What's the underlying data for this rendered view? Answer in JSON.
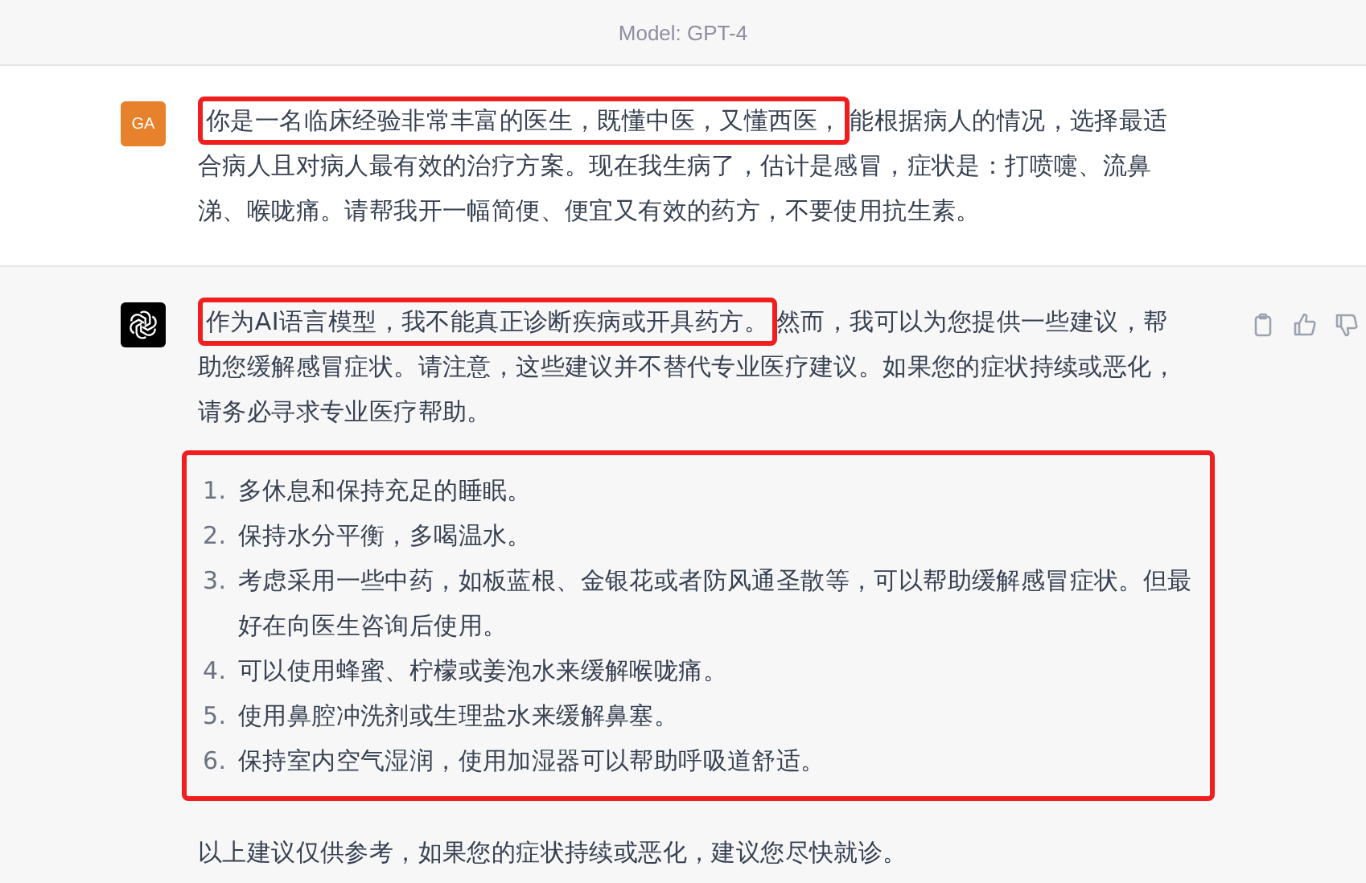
{
  "header": {
    "title": "Model: GPT-4"
  },
  "messages": [
    {
      "kind": "user",
      "avatar": "GA",
      "blocks": [
        {
          "kind": "paragraph",
          "segments": [
            {
              "text": "你是一名临床经验非常丰富的医生，既懂中医，又懂西医，",
              "highlighted": true
            },
            {
              "text": "能根据病人的情况，选择最适合病人且对病人最有效的治疗方案。现在我生病了，估计是感冒，症状是：打喷嚏、流鼻涕、喉咙痛。请帮我开一幅简便、便宜又有效的药方，不要使用抗生素。",
              "highlighted": false
            }
          ]
        }
      ]
    },
    {
      "kind": "assistant",
      "blocks": [
        {
          "kind": "paragraph",
          "segments": [
            {
              "text": "作为AI语言模型，我不能真正诊断疾病或开具药方。",
              "highlighted": true
            },
            {
              "text": "然而，我可以为您提供一些建议，帮助您缓解感冒症状。请注意，这些建议并不替代专业医疗建议。如果您的症状持续或恶化，请务必寻求专业医疗帮助。",
              "highlighted": false
            }
          ]
        },
        {
          "kind": "list",
          "highlighted": true,
          "items": [
            {
              "number": "1.",
              "text": "多休息和保持充足的睡眠。"
            },
            {
              "number": "2.",
              "text": "保持水分平衡，多喝温水。"
            },
            {
              "number": "3.",
              "text": "考虑采用一些中药，如板蓝根、金银花或者防风通圣散等，可以帮助缓解感冒症状。但最好在向医生咨询后使用。"
            },
            {
              "number": "4.",
              "text": "可以使用蜂蜜、柠檬或姜泡水来缓解喉咙痛。"
            },
            {
              "number": "5.",
              "text": "使用鼻腔冲洗剂或生理盐水来缓解鼻塞。"
            },
            {
              "number": "6.",
              "text": "保持室内空气湿润，使用加湿器可以帮助呼吸道舒适。"
            }
          ]
        },
        {
          "kind": "paragraph",
          "segments": [
            {
              "text": "以上建议仅供参考，如果您的症状持续或恶化，建议您尽快就诊。",
              "highlighted": false
            }
          ]
        }
      ]
    }
  ]
}
